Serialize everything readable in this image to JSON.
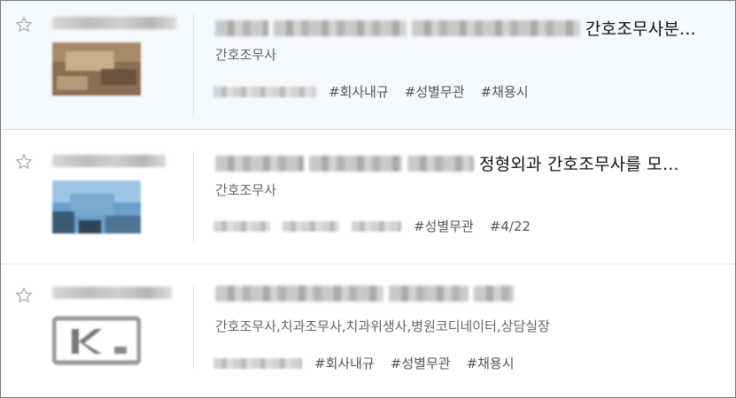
{
  "listings": [
    {
      "title_visible": "간호조무사분...",
      "job_category": "간호조무사",
      "tags": [
        "#회사내규",
        "#성별무관",
        "#채용시"
      ],
      "starred": false,
      "highlighted": true,
      "logo_colors": [
        "#8a6e52",
        "#c7b08d",
        "#6b543f"
      ]
    },
    {
      "title_visible": "정형외과 간호조무사를 모...",
      "job_category": "간호조무사",
      "tags": [
        "#성별무관",
        "#4/22"
      ],
      "starred": false,
      "highlighted": false,
      "logo_colors": [
        "#6a9fd0",
        "#9cc6e6",
        "#3c5a74"
      ]
    },
    {
      "title_visible": "",
      "job_category": "간호조무사,치과조무사,치과위생사,병원코디네이터,상담실장",
      "tags": [
        "#회사내규",
        "#성별무관",
        "#채용시"
      ],
      "starred": false,
      "highlighted": false,
      "logo_colors": [
        "#777777",
        "#bbbbbb",
        "#ffffff"
      ]
    }
  ],
  "icons": {
    "star": "star-outline-icon"
  },
  "colors": {
    "highlight_bg": "#f5f8fc",
    "divider": "#d9dde3",
    "tag_text": "#555555"
  }
}
